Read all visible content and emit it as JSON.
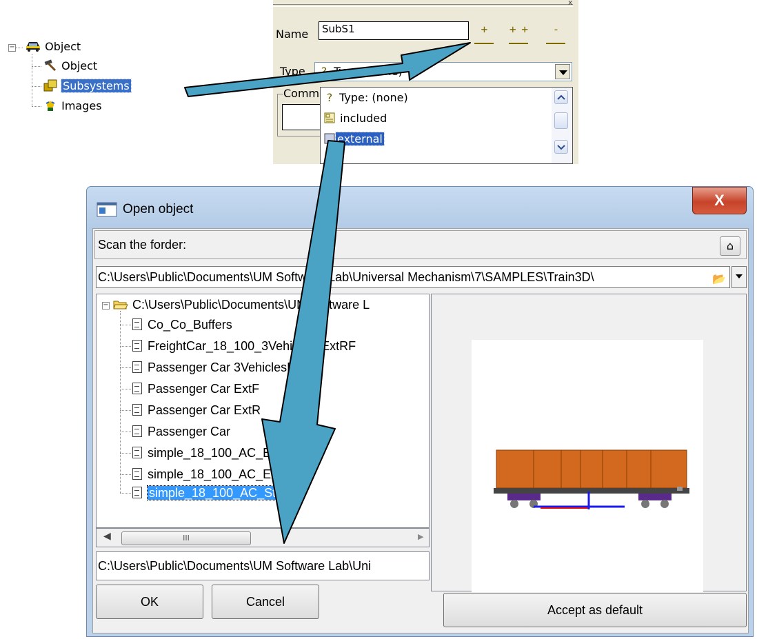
{
  "left_tree": {
    "root_label": "Object",
    "children": [
      {
        "label": "Object",
        "icon": "hammer-icon"
      },
      {
        "label": "Subsystems",
        "icon": "subsystems-icon",
        "selected": true
      },
      {
        "label": "Images",
        "icon": "images-icon"
      }
    ]
  },
  "top_panel": {
    "name_label": "Name",
    "name_value": "SubS1",
    "type_label": "Type",
    "type_selected": "Type: (none)",
    "comment_label_partial": "Comm",
    "options": [
      {
        "label": "Type: (none)",
        "icon": "question-icon"
      },
      {
        "label": "included",
        "icon": "included-icon"
      },
      {
        "label": "external",
        "icon": "external-icon",
        "highlighted": true
      }
    ],
    "toolbar_glyphs": [
      "+",
      "+ +",
      "-"
    ]
  },
  "dialog": {
    "title": "Open object",
    "close_glyph": "X",
    "scan_label": "Scan the forder:",
    "path": "C:\\Users\\Public\\Documents\\UM Software Lab\\Universal Mechanism\\7\\SAMPLES\\Train3D\\",
    "tree_root": "C:\\Users\\Public\\Documents\\UM Software L",
    "files": [
      "Co_Co_Buffers",
      "FreightCar_18_100_3Vehicles_ExtRF",
      "Passenger Car 3VehiclesExtRF",
      "Passenger Car ExtF",
      "Passenger Car ExtR",
      "Passenger Car",
      "simple_18_100_AC_ExtF",
      "simple_18_100_AC_ExtR",
      "simple_18_100_AC_Std"
    ],
    "selected_file": "simple_18_100_AC_Std",
    "hscroll_thumb": "III",
    "status_path": "C:\\Users\\Public\\Documents\\UM Software Lab\\Uni",
    "ok_label": "OK",
    "cancel_label": "Cancel",
    "accept_label": "Accept as default"
  },
  "colors": {
    "selection": "#3399ff",
    "tree_selection": "#3a6fc8",
    "arrow_fill": "#4aa3c4",
    "wagon_body": "#d2691e",
    "panel_bg": "#ece9d8"
  }
}
